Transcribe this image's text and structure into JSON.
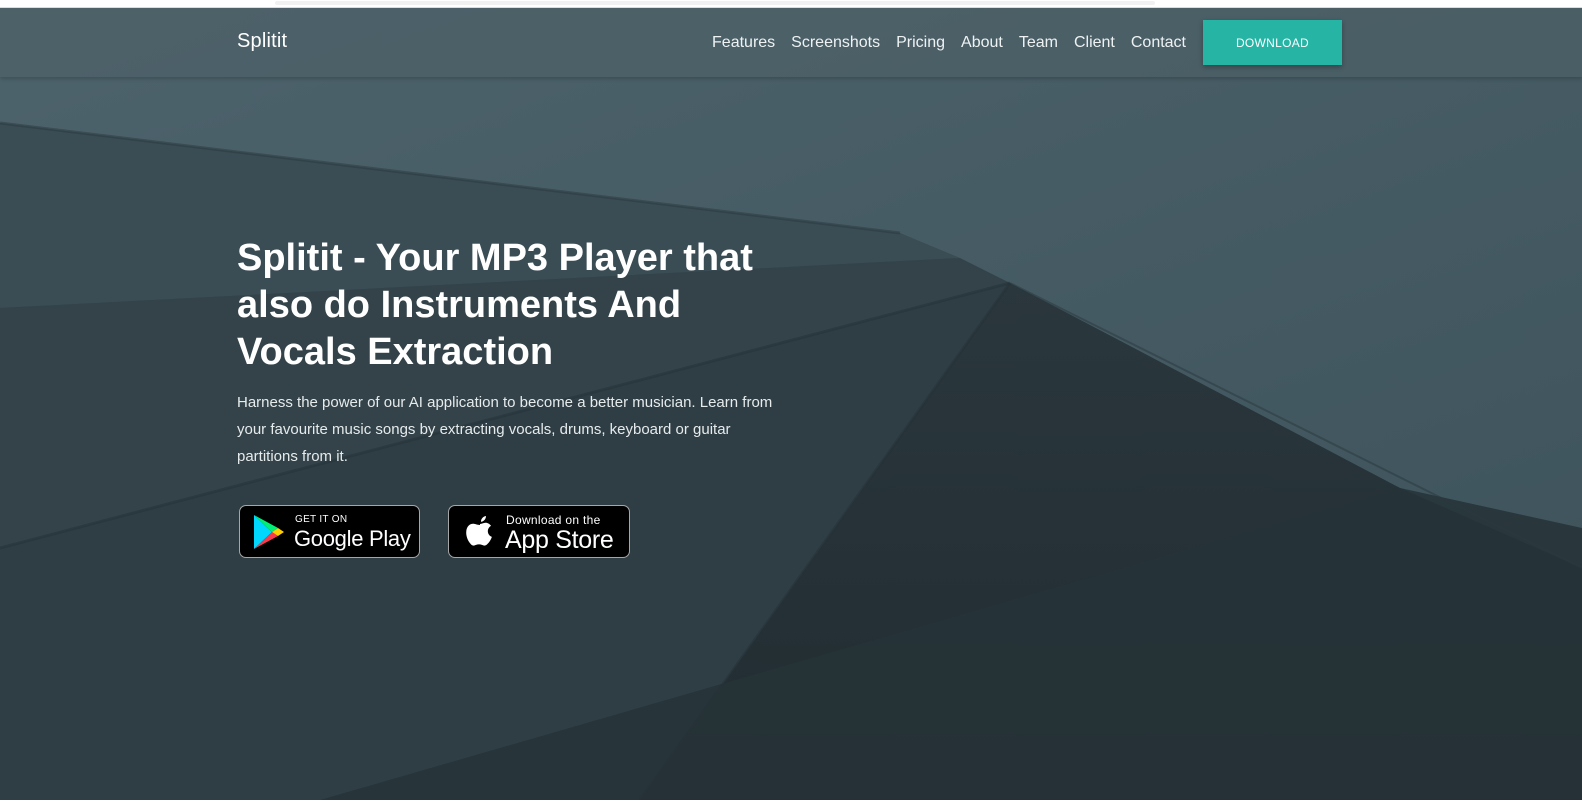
{
  "navbar": {
    "brand": "Splitit",
    "links": [
      {
        "label": "Features"
      },
      {
        "label": "Screenshots"
      },
      {
        "label": "Pricing"
      },
      {
        "label": "About"
      },
      {
        "label": "Team"
      },
      {
        "label": "Client"
      },
      {
        "label": "Contact"
      }
    ],
    "download_label": "DOWNLOAD"
  },
  "hero": {
    "title": "Splitit - Your MP3 Player that also do Instruments And Vocals Extraction",
    "description": "Harness the power of our AI application to become a better musician. Learn from your favourite music songs by extracting vocals, drums, keyboard or guitar partitions from it."
  },
  "badges": {
    "google": {
      "small": "GET IT ON",
      "big": "Google Play",
      "icon": "google-play-icon"
    },
    "apple": {
      "small": "Download on the",
      "big": "App Store",
      "icon": "apple-icon"
    }
  },
  "colors": {
    "accent": "#26b5a5",
    "background_dark": "#2c3b42",
    "background_light": "#4a5f68"
  }
}
